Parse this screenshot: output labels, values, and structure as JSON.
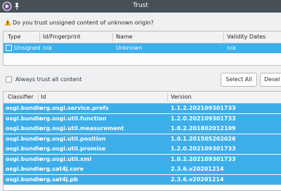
{
  "window": {
    "title": "Trust"
  },
  "question": "Do you trust unsigned content of unknown origin?",
  "origin_table": {
    "columns": [
      "Type",
      "Id/Fingerprint",
      "Name",
      "Validity Dates"
    ],
    "rows": [
      {
        "type": "Unsigned",
        "id": "n/a",
        "name": "Unknown",
        "validity": "n/a"
      }
    ]
  },
  "always_trust_label": "Always trust all content",
  "buttons": {
    "select_all": "Select All",
    "deselect": "Desel"
  },
  "content_table": {
    "columns": [
      "Classifier",
      "Id",
      "Version"
    ],
    "rows": [
      {
        "classifier": "osgi.bundle",
        "id": "org.osgi.service.prefs",
        "version": "1.1.2.202109301733"
      },
      {
        "classifier": "osgi.bundle",
        "id": "org.osgi.util.function",
        "version": "1.2.0.202109301733"
      },
      {
        "classifier": "osgi.bundle",
        "id": "org.osgi.util.measurement",
        "version": "1.0.2.201802012109"
      },
      {
        "classifier": "osgi.bundle",
        "id": "org.osgi.util.position",
        "version": "1.0.1.201505202026"
      },
      {
        "classifier": "osgi.bundle",
        "id": "org.osgi.util.promise",
        "version": "1.2.0.202109301733"
      },
      {
        "classifier": "osgi.bundle",
        "id": "org.osgi.util.xml",
        "version": "1.0.2.202109301733"
      },
      {
        "classifier": "osgi.bundle",
        "id": "org.sat4j.core",
        "version": "2.3.6.v20201214"
      },
      {
        "classifier": "osgi.bundle",
        "id": "org.sat4j.pb",
        "version": "2.3.6.v20201214"
      }
    ]
  },
  "colors": {
    "titlebar": "#475057",
    "selection": "#3daee9",
    "warning": "#f6b832"
  }
}
